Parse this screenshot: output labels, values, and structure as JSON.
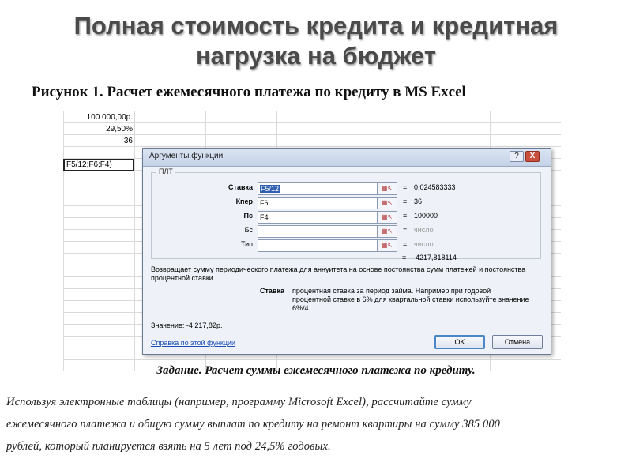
{
  "slide": {
    "title_line1": "Полная стоимость кредита и кредитная",
    "title_line2": "нагрузка на бюджет",
    "figure_caption": "Рисунок 1. Расчет ежемесячного платежа по кредиту в MS Excel"
  },
  "sheet": {
    "cells": [
      "100 000,00р.",
      "29,50%",
      "36"
    ],
    "formula_fragment": "F5/12;F6;F4)"
  },
  "dialog": {
    "title": "Аргументы функции",
    "help_btn": "?",
    "close_btn": "X",
    "function_name": "ПЛТ",
    "args": [
      {
        "label": "Ставка",
        "value": "F5/12",
        "result": "0,024583333"
      },
      {
        "label": "Кпер",
        "value": "F6",
        "result": "36"
      },
      {
        "label": "Пс",
        "value": "F4",
        "result": "100000"
      },
      {
        "label": "Бс",
        "value": "",
        "result": "число"
      },
      {
        "label": "Тип",
        "value": "",
        "result": "число"
      }
    ],
    "eq": "=",
    "total_result": "-4217,818114",
    "description": "Возвращает сумму периодического платежа для аннуитета на основе постоянства сумм платежей и постоянства процентной ставки.",
    "arg_help_label": "Ставка",
    "arg_help_text": "процентная ставка за период займа. Например при годовой процентной ставке в 6% для квартальной ставки используйте значение 6%/4.",
    "value_line": "Значение:   -4 217,82р.",
    "help_link": "Справка по этой функции",
    "ok_label": "OK",
    "cancel_label": "Отмена"
  },
  "task": {
    "title": "Задание. Расчет суммы ежемесячного платежа по кредиту.",
    "line1": "Используя электронные таблицы (например, программу Microsoft Excel), рассчитайте сумму",
    "line2": "ежемесячного платежа и общую сумму выплат по кредиту на ремонт квартиры на сумму 385 000",
    "line3": "рублей, который планируется взять на 5 лет под 24,5% годовых."
  }
}
